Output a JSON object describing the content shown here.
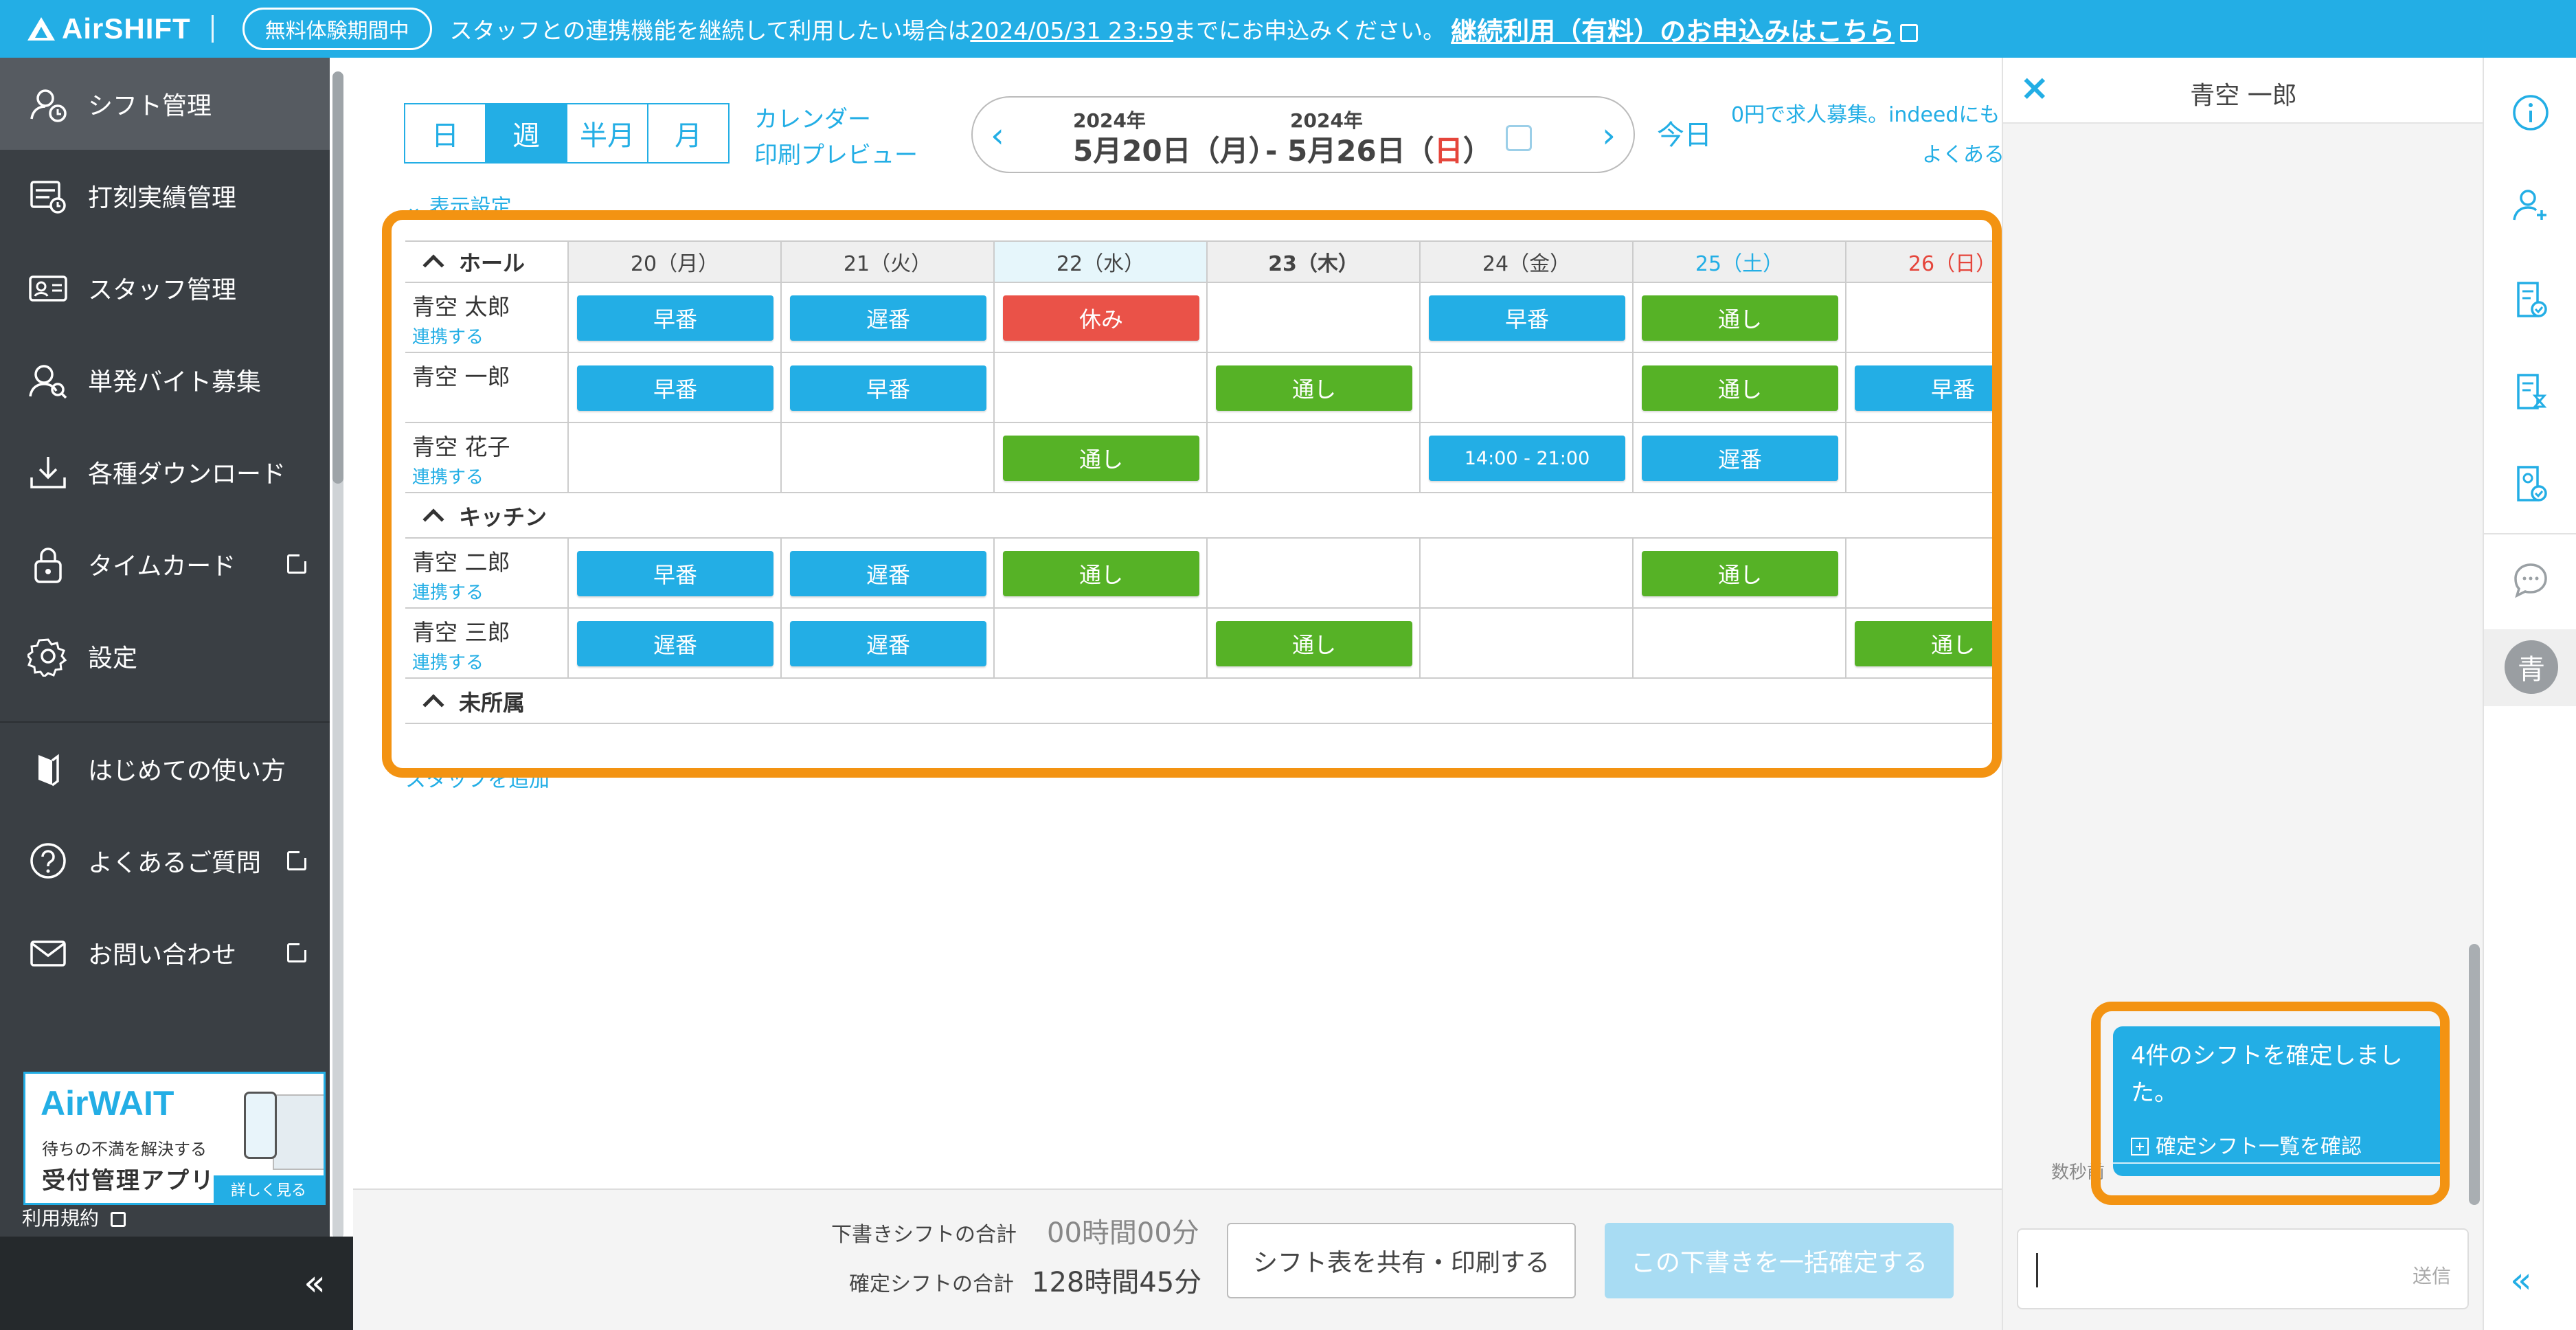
{
  "banner": {
    "logo": "AirSHIFT",
    "trial_label": "無料体験期間中",
    "message_pre": "スタッフとの連携機能を継続して利用したい場合は",
    "deadline": "2024/05/31 23:59",
    "message_post": "までにお申込みください。",
    "cta": "継続利用（有料）のお申込みはこちら"
  },
  "sidebar": {
    "items": [
      {
        "label": "シフト管理",
        "icon": "shift-icon",
        "active": true
      },
      {
        "label": "打刻実績管理",
        "icon": "timecard-record-icon"
      },
      {
        "label": "スタッフ管理",
        "icon": "staff-card-icon"
      },
      {
        "label": "単発バイト募集",
        "icon": "recruit-icon"
      },
      {
        "label": "各種ダウンロード",
        "icon": "download-icon"
      },
      {
        "label": "タイムカード",
        "icon": "lock-icon",
        "external": true
      },
      {
        "label": "設定",
        "icon": "gear-icon"
      },
      {
        "label": "はじめての使い方",
        "icon": "guide-icon"
      },
      {
        "label": "よくあるご質問",
        "icon": "question-icon",
        "external": true
      },
      {
        "label": "お問い合わせ",
        "icon": "mail-icon",
        "external": true
      }
    ],
    "ad": {
      "logo": "AirWAIT",
      "sub": "待ちの不満を解決する",
      "main": "受付管理アプリ",
      "button": "詳しく見る"
    },
    "terms": "利用規約",
    "collapse": "«"
  },
  "toolbar": {
    "view_tabs": [
      "日",
      "週",
      "半月",
      "月"
    ],
    "selected_view": "週",
    "calendar_link": "カレンダー",
    "print_preview": "印刷プレビュー",
    "start_year": "2024年",
    "start_date": "5月20日（月）",
    "end_year": "2024年",
    "end_date_pre": "- 5月26日（",
    "end_date_day": "日",
    "end_date_post": "）",
    "today": "今日",
    "promo": "0円で求人募集。indeedにも",
    "faq": "よくある",
    "display_settings": "表示設定"
  },
  "schedule": {
    "days": [
      {
        "label": "20（月）",
        "type": "normal"
      },
      {
        "label": "21（火）",
        "type": "normal"
      },
      {
        "label": "22（水）",
        "type": "today"
      },
      {
        "label": "23（木）",
        "type": "bold"
      },
      {
        "label": "24（金）",
        "type": "normal"
      },
      {
        "label": "25（土）",
        "type": "sat"
      },
      {
        "label": "26（日）",
        "type": "sun"
      }
    ],
    "groups": [
      {
        "name": "ホール",
        "staff": [
          {
            "name": "青空 太郎",
            "link": "連携する",
            "shifts": [
              [
                "早番",
                "blue"
              ],
              [
                "遅番",
                "blue"
              ],
              [
                "休み",
                "red"
              ],
              null,
              [
                "早番",
                "blue"
              ],
              [
                "通し",
                "green"
              ],
              null
            ]
          },
          {
            "name": "青空 一郎",
            "link": "",
            "shifts": [
              [
                "早番",
                "blue"
              ],
              [
                "早番",
                "blue"
              ],
              null,
              [
                "通し",
                "green"
              ],
              null,
              [
                "通し",
                "green"
              ],
              [
                "早番",
                "blue"
              ]
            ]
          },
          {
            "name": "青空 花子",
            "link": "連携する",
            "shifts": [
              null,
              null,
              [
                "通し",
                "green"
              ],
              null,
              [
                "14:00 - 21:00",
                "blue"
              ],
              [
                "遅番",
                "blue"
              ],
              null
            ]
          }
        ]
      },
      {
        "name": "キッチン",
        "staff": [
          {
            "name": "青空 二郎",
            "link": "連携する",
            "shifts": [
              [
                "早番",
                "blue"
              ],
              [
                "遅番",
                "blue"
              ],
              [
                "通し",
                "green"
              ],
              null,
              null,
              [
                "通し",
                "green"
              ],
              null
            ]
          },
          {
            "name": "青空 三郎",
            "link": "連携する",
            "shifts": [
              [
                "遅番",
                "blue"
              ],
              [
                "遅番",
                "blue"
              ],
              null,
              [
                "通し",
                "green"
              ],
              null,
              null,
              [
                "通し",
                "green"
              ]
            ]
          }
        ]
      },
      {
        "name": "未所属",
        "staff": []
      }
    ],
    "add_staff": "スタッフを追加"
  },
  "footer": {
    "draft_label": "下書きシフトの合計",
    "draft_value": "00時間00分",
    "confirmed_label": "確定シフトの合計",
    "confirmed_value": "128時間45分",
    "share_button": "シフト表を共有・印刷する",
    "confirm_button": "この下書きを一括確定する"
  },
  "chat": {
    "title": "青空 一郎",
    "close": "×",
    "message": "4件のシフトを確定しました。",
    "message_link": "確定シフト一覧を確認",
    "time_ago": "数秒前",
    "input_placeholder": "",
    "send": "送信"
  },
  "rail": {
    "avatar": "青",
    "collapse": "«"
  },
  "colors": {
    "brand": "#23aee5",
    "shift_blue": "#23aee5",
    "shift_green": "#56b226",
    "shift_red": "#ea5248",
    "highlight": "#f39312"
  }
}
